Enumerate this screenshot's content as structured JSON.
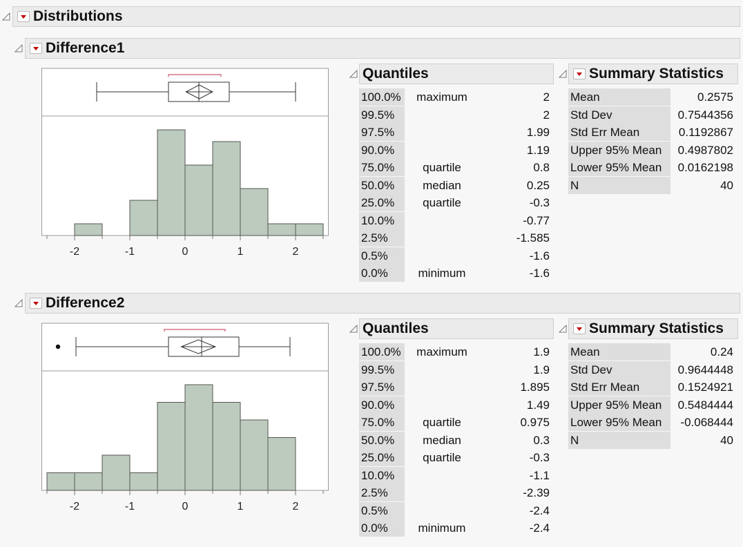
{
  "report": {
    "title": "Distributions"
  },
  "sections": [
    {
      "title": "Difference1",
      "quantiles": {
        "title": "Quantiles",
        "rows": [
          {
            "pct": "100.0%",
            "label": "maximum",
            "value": "2"
          },
          {
            "pct": "99.5%",
            "label": "",
            "value": "2"
          },
          {
            "pct": "97.5%",
            "label": "",
            "value": "1.99"
          },
          {
            "pct": "90.0%",
            "label": "",
            "value": "1.19"
          },
          {
            "pct": "75.0%",
            "label": "quartile",
            "value": "0.8"
          },
          {
            "pct": "50.0%",
            "label": "median",
            "value": "0.25"
          },
          {
            "pct": "25.0%",
            "label": "quartile",
            "value": "-0.3"
          },
          {
            "pct": "10.0%",
            "label": "",
            "value": "-0.77"
          },
          {
            "pct": "2.5%",
            "label": "",
            "value": "-1.585"
          },
          {
            "pct": "0.5%",
            "label": "",
            "value": "-1.6"
          },
          {
            "pct": "0.0%",
            "label": "minimum",
            "value": "-1.6"
          }
        ]
      },
      "summary": {
        "title": "Summary Statistics",
        "rows": [
          {
            "label": "Mean",
            "value": "0.2575"
          },
          {
            "label": "Std Dev",
            "value": "0.7544356"
          },
          {
            "label": "Std Err Mean",
            "value": "0.1192867"
          },
          {
            "label": "Upper 95% Mean",
            "value": "0.4987802"
          },
          {
            "label": "Lower 95% Mean",
            "value": "0.0162198"
          },
          {
            "label": "N",
            "value": "40"
          }
        ]
      }
    },
    {
      "title": "Difference2",
      "quantiles": {
        "title": "Quantiles",
        "rows": [
          {
            "pct": "100.0%",
            "label": "maximum",
            "value": "1.9"
          },
          {
            "pct": "99.5%",
            "label": "",
            "value": "1.9"
          },
          {
            "pct": "97.5%",
            "label": "",
            "value": "1.895"
          },
          {
            "pct": "90.0%",
            "label": "",
            "value": "1.49"
          },
          {
            "pct": "75.0%",
            "label": "quartile",
            "value": "0.975"
          },
          {
            "pct": "50.0%",
            "label": "median",
            "value": "0.3"
          },
          {
            "pct": "25.0%",
            "label": "quartile",
            "value": "-0.3"
          },
          {
            "pct": "10.0%",
            "label": "",
            "value": "-1.1"
          },
          {
            "pct": "2.5%",
            "label": "",
            "value": "-2.39"
          },
          {
            "pct": "0.5%",
            "label": "",
            "value": "-2.4"
          },
          {
            "pct": "0.0%",
            "label": "minimum",
            "value": "-2.4"
          }
        ]
      },
      "summary": {
        "title": "Summary Statistics",
        "rows": [
          {
            "label": "Mean",
            "value": "0.24"
          },
          {
            "label": "Std Dev",
            "value": "0.9644448"
          },
          {
            "label": "Std Err Mean",
            "value": "0.1524921"
          },
          {
            "label": "Upper 95% Mean",
            "value": "0.5484444"
          },
          {
            "label": "Lower 95% Mean",
            "value": "-0.068444"
          },
          {
            "label": "N",
            "value": "40"
          }
        ]
      }
    }
  ],
  "chart_data": [
    {
      "type": "bar",
      "subtype": "histogram",
      "bin_edges": [
        -2.5,
        -2,
        -1.5,
        -1,
        -0.5,
        0,
        0.5,
        1,
        1.5,
        2,
        2.5
      ],
      "counts": [
        0,
        1,
        0,
        3,
        9,
        6,
        8,
        4,
        1,
        1
      ],
      "xlim": [
        -2.5,
        2.5
      ],
      "xticks": [
        -2,
        -1,
        0,
        1,
        2
      ],
      "grid": false,
      "boxplot": {
        "min": -1.6,
        "q1": -0.3,
        "median": 0.25,
        "q3": 0.8,
        "max": 2,
        "mean": 0.2575,
        "mean_ci": [
          0.0162198,
          0.4987802
        ],
        "shortest_half": [
          -0.3,
          0.65
        ],
        "outliers": []
      },
      "colors": {
        "bar_fill": "#bccbbd",
        "bar_stroke": "#555555",
        "bracket": "#c0304a"
      }
    },
    {
      "type": "bar",
      "subtype": "histogram",
      "bin_edges": [
        -2.5,
        -2,
        -1.5,
        -1,
        -0.5,
        0,
        0.5,
        1,
        1.5,
        2,
        2.5
      ],
      "counts": [
        1,
        1,
        2,
        1,
        5,
        6,
        5,
        4,
        3,
        0
      ],
      "xlim": [
        -2.5,
        2.5
      ],
      "xticks": [
        -2,
        -1,
        0,
        1,
        2
      ],
      "grid": false,
      "boxplot": {
        "min": -1.975,
        "q1": -0.3,
        "median": 0.3,
        "q3": 0.975,
        "max": 1.9,
        "mean": 0.24,
        "mean_ci": [
          -0.068444,
          0.5484444
        ],
        "shortest_half": [
          -0.375,
          0.725
        ],
        "outliers": [
          -2.4
        ]
      },
      "colors": {
        "bar_fill": "#bccbbd",
        "bar_stroke": "#555555",
        "bracket": "#c0304a"
      }
    }
  ]
}
